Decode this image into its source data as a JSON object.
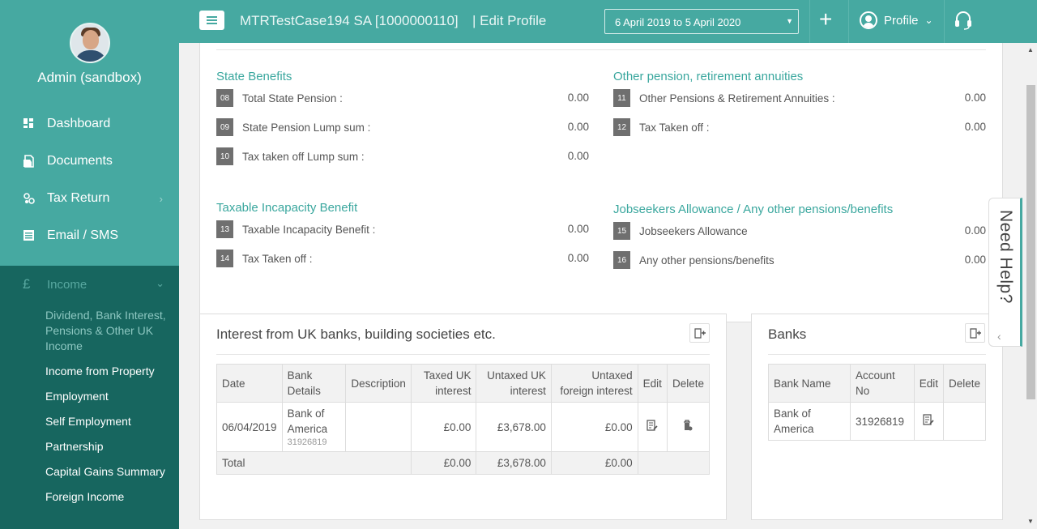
{
  "sidebar": {
    "user_name": "Admin (sandbox)",
    "nav": [
      {
        "label": "Dashboard",
        "icon": "dashboard-icon"
      },
      {
        "label": "Documents",
        "icon": "documents-icon"
      },
      {
        "label": "Tax Return",
        "icon": "tax-return-icon"
      },
      {
        "label": "Email / SMS",
        "icon": "email-icon"
      }
    ],
    "income": {
      "label": "Income",
      "icon_glyph": "£",
      "items": [
        "Dividend, Bank Interest, Pensions & Other UK Income",
        "Income from Property",
        "Employment",
        "Self Employment",
        "Partnership",
        "Capital Gains Summary",
        "Foreign Income"
      ]
    }
  },
  "topbar": {
    "client": "MTRTestCase194 SA [1000000110]",
    "page": "| Edit Profile",
    "period": "6 April 2019 to 5 April 2020",
    "plus": "+",
    "profile_label": "Profile"
  },
  "benefits": {
    "state": {
      "title": "State Benefits",
      "rows": [
        {
          "code": "08",
          "label": "Total State Pension :",
          "value": "0.00"
        },
        {
          "code": "09",
          "label": "State Pension Lump sum :",
          "value": "0.00"
        },
        {
          "code": "10",
          "label": "Tax taken off Lump sum :",
          "value": "0.00"
        }
      ]
    },
    "other": {
      "title": "Other pension, retirement annuities",
      "rows": [
        {
          "code": "11",
          "label": "Other Pensions & Retirement Annuities :",
          "value": "0.00"
        },
        {
          "code": "12",
          "label": "Tax Taken off :",
          "value": "0.00"
        }
      ]
    },
    "incapacity": {
      "title": "Taxable Incapacity Benefit",
      "rows": [
        {
          "code": "13",
          "label": "Taxable Incapacity Benefit :",
          "value": "0.00"
        },
        {
          "code": "14",
          "label": "Tax Taken off :",
          "value": "0.00"
        }
      ]
    },
    "jobseekers": {
      "title": "Jobseekers Allowance / Any other pensions/benefits",
      "rows": [
        {
          "code": "15",
          "label": "Jobseekers Allowance",
          "value": "0.00"
        },
        {
          "code": "16",
          "label": "Any other pensions/benefits",
          "value": "0.00"
        }
      ]
    }
  },
  "interest": {
    "title": "Interest from UK banks, building societies etc.",
    "headers": [
      "Date",
      "Bank Details",
      "Description",
      "Taxed UK interest",
      "Untaxed UK interest",
      "Untaxed foreign interest",
      "Edit",
      "Delete"
    ],
    "row": {
      "date": "06/04/2019",
      "bank": "Bank of America",
      "account": "31926819",
      "description": "",
      "taxed": "£0.00",
      "untaxed": "£3,678.00",
      "foreign": "£0.00"
    },
    "total": {
      "label": "Total",
      "taxed": "£0.00",
      "untaxed": "£3,678.00",
      "foreign": "£0.00"
    }
  },
  "banks": {
    "title": "Banks",
    "headers": [
      "Bank Name",
      "Account No",
      "Edit",
      "Delete"
    ],
    "row": {
      "name": "Bank of America",
      "account": "31926819"
    }
  },
  "help": {
    "label": "Need Help?"
  },
  "colors": {
    "primary": "#46a9a1",
    "sidebar_dark": "#17665f",
    "section_title": "#3aa79e",
    "badge": "#6f6f6f"
  }
}
